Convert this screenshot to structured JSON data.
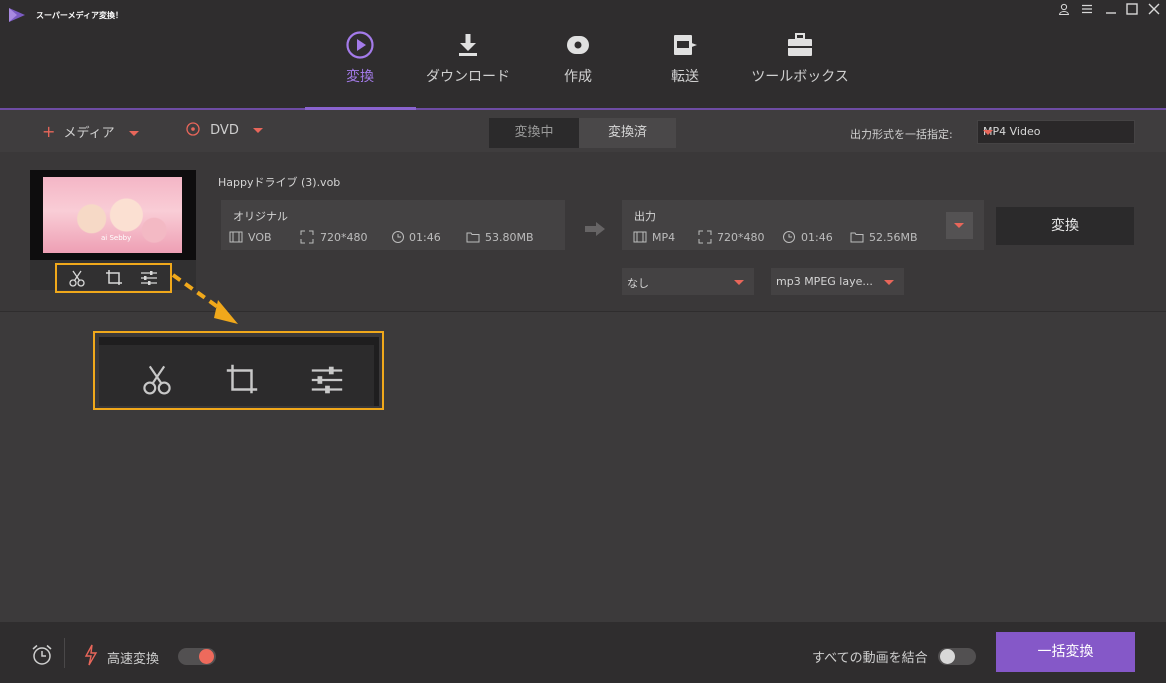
{
  "app": {
    "title": "スーパーメディア変換！"
  },
  "window_controls": [
    "user-icon",
    "menu-icon",
    "minimize-icon",
    "maximize-icon",
    "close-icon"
  ],
  "nav": [
    {
      "label": "変換",
      "icon": "convert-icon",
      "active": true
    },
    {
      "label": "ダウンロード",
      "icon": "download-icon",
      "active": false
    },
    {
      "label": "作成",
      "icon": "disc-icon",
      "active": false
    },
    {
      "label": "転送",
      "icon": "transfer-icon",
      "active": false
    },
    {
      "label": "ツールボックス",
      "icon": "toolbox-icon",
      "active": false
    }
  ],
  "toolbar": {
    "add_media": "メディア",
    "dvd": "DVD",
    "tab_converting": "変換中",
    "tab_converted": "変換済",
    "output_format_label": "出力形式を一括指定:",
    "output_format_value": "MP4 Video"
  },
  "file": {
    "name": "Happyドライブ (3).vob",
    "thumb_caption": "ai Sebby",
    "original": {
      "title": "オリジナル",
      "format": "VOB",
      "resolution": "720*480",
      "duration": "01:46",
      "size": "53.80MB"
    },
    "output": {
      "title": "出力",
      "format": "MP4",
      "resolution": "720*480",
      "duration": "01:46",
      "size": "52.56MB"
    },
    "convert_label": "変換",
    "subtitle_select": "なし",
    "audio_select": "mp3 MPEG laye..."
  },
  "bottom": {
    "fast_convert": "高速変換",
    "fast_convert_on": true,
    "merge_all": "すべての動画を結合",
    "merge_all_on": false,
    "batch_convert": "一括変換"
  },
  "colors": {
    "accent_purple": "#8558c8",
    "accent_orange": "#e8665a",
    "highlight": "#f0a81b"
  }
}
